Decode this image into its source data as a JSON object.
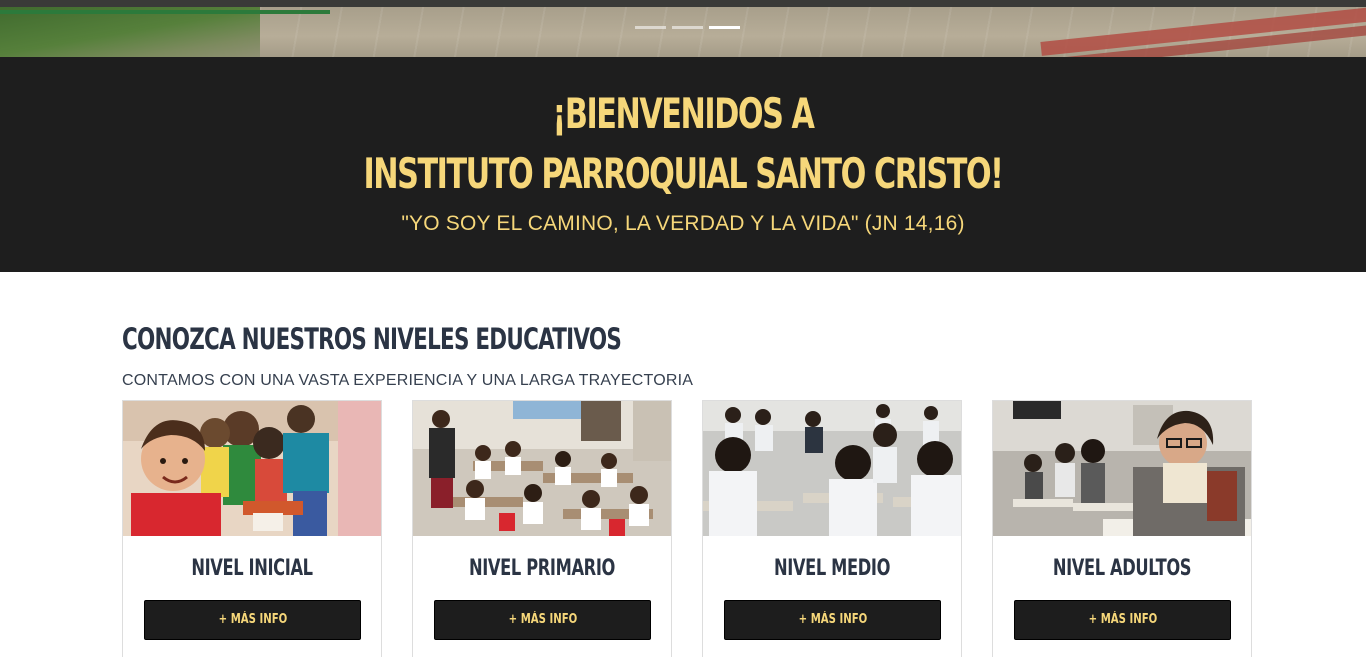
{
  "hero": {
    "slider": {
      "slide_count": 3,
      "active_index": 2
    }
  },
  "welcome": {
    "title_line1": "¡BIENVENIDOS A",
    "title_line2": "INSTITUTO PARROQUIAL SANTO CRISTO!",
    "quote": "\"YO SOY EL CAMINO, LA VERDAD Y LA VIDA\" (JN 14,16)"
  },
  "levels": {
    "title": "CONOZCA NUESTROS NIVELES EDUCATIVOS",
    "subtitle": "CONTAMOS CON UNA VASTA EXPERIENCIA Y UNA LARGA TRAYECTORIA",
    "cards": [
      {
        "title": "NIVEL INICIAL",
        "button_label": "+ MÁS INFO"
      },
      {
        "title": "NIVEL PRIMARIO",
        "button_label": "+ MÁS INFO"
      },
      {
        "title": "NIVEL MEDIO",
        "button_label": "+ MÁS INFO"
      },
      {
        "title": "NIVEL ADULTOS",
        "button_label": "+ MÁS INFO"
      }
    ]
  },
  "colors": {
    "accent_gold": "#f6d77a",
    "band_dark": "#1e1e1e",
    "heading_navy": "#2b3444",
    "button_dark": "#1d1d1d"
  }
}
